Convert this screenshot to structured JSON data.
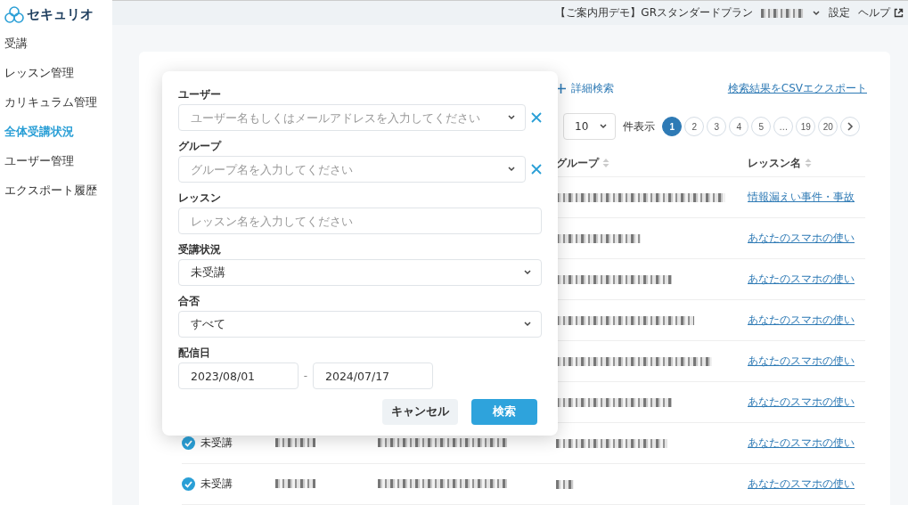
{
  "sidebar": {
    "logo": "セキュリオ",
    "items": [
      {
        "label": "受講",
        "selected": false
      },
      {
        "label": "レッスン管理",
        "selected": false
      },
      {
        "label": "カリキュラム管理",
        "selected": false
      },
      {
        "label": "全体受講状況",
        "selected": true
      },
      {
        "label": "ユーザー管理",
        "selected": false
      },
      {
        "label": "エクスポート履歴",
        "selected": false
      }
    ]
  },
  "topbar": {
    "plan": "【ご案内用デモ】GRスタンダードプラン",
    "links": [
      "設定",
      "ヘルプ"
    ]
  },
  "toolbar": {
    "advanced_search": "詳細検索",
    "export_link": "検索結果をCSVエクスポート",
    "page_size": "10",
    "page_size_suffix": "件表示",
    "pages": [
      {
        "label": "1",
        "selected": true
      },
      {
        "label": "2",
        "selected": false
      },
      {
        "label": "3",
        "selected": false
      },
      {
        "label": "4",
        "selected": false
      },
      {
        "label": "5",
        "selected": false
      },
      {
        "label": "…",
        "selected": false
      },
      {
        "label": "19",
        "selected": false
      },
      {
        "label": "20",
        "selected": false
      }
    ]
  },
  "table": {
    "columns": [
      "グループ",
      "レッスン名"
    ],
    "rows": [
      {
        "lesson": "情報漏えい事件・事故"
      },
      {
        "lesson": "あなたのスマホの使い"
      },
      {
        "lesson": "あなたのスマホの使い"
      },
      {
        "lesson": "あなたのスマホの使い"
      },
      {
        "lesson": "あなたのスマホの使い"
      },
      {
        "lesson": "あなたのスマホの使い"
      },
      {
        "status": "未受講",
        "lesson": "あなたのスマホの使い"
      },
      {
        "status": "未受講",
        "lesson": "あなたのスマホの使い"
      }
    ]
  },
  "dialog": {
    "fields": [
      {
        "kind": "combo",
        "label": "ユーザー",
        "placeholder": "ユーザー名もしくはメールアドレスを入力してください",
        "clearable": true
      },
      {
        "kind": "combo",
        "label": "グループ",
        "placeholder": "グループ名を入力してください",
        "clearable": true
      },
      {
        "kind": "text",
        "label": "レッスン",
        "placeholder": "レッスン名を入力してください"
      },
      {
        "kind": "select",
        "label": "受講状況",
        "value": "未受講"
      },
      {
        "kind": "select",
        "label": "合否",
        "value": "すべて"
      },
      {
        "kind": "daterange",
        "label": "配信日",
        "from": "2023/08/01",
        "separator": "-",
        "to": "2024/07/17"
      }
    ],
    "buttons": [
      {
        "label": "キャンセル",
        "kind": "secondary"
      },
      {
        "label": "検索",
        "kind": "primary"
      }
    ]
  }
}
